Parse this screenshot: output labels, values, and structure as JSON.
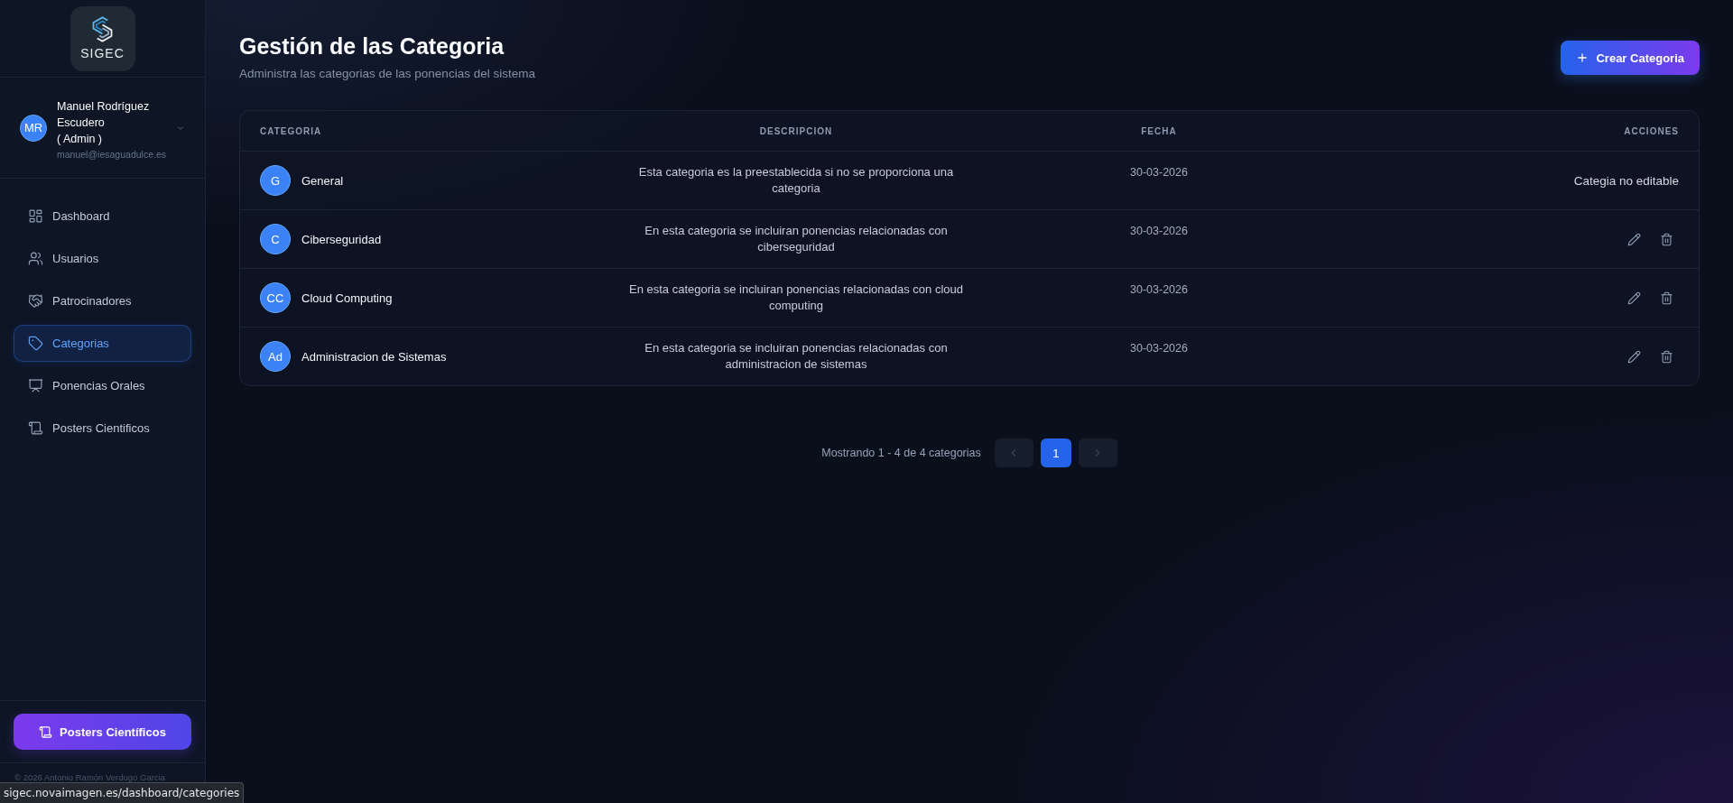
{
  "sidebar": {
    "logo": {
      "text": "SIGEC"
    },
    "user": {
      "initials": "MR",
      "name": "Manuel Rodríguez Escudero",
      "role": "( Admin )",
      "email": "manuel@iesaguadulce.es"
    },
    "nav": [
      {
        "label": "Dashboard",
        "selected": false
      },
      {
        "label": "Usuarios",
        "selected": false
      },
      {
        "label": "Patrocinadores",
        "selected": false
      },
      {
        "label": "Categorias",
        "selected": true
      },
      {
        "label": "Ponencias Orales",
        "selected": false
      },
      {
        "label": "Posters Cientificos",
        "selected": false
      }
    ],
    "bottom_button": {
      "label": "Posters Científicos"
    },
    "footer": "© 2026 Antonio Ramón Verdugo Garcia"
  },
  "header": {
    "title": "Gestión de las Categoria",
    "subtitle": "Administra las categorias de las ponencias del sistema",
    "create_button": {
      "label": "Crear Categoria"
    }
  },
  "table": {
    "columns": [
      "CATEGORIA",
      "DESCRIPCION",
      "FECHA",
      "ACCIONES"
    ],
    "rows": [
      {
        "initials": "G",
        "name": "General",
        "description": "Esta categoria es la preestablecida si no se proporciona una categoria",
        "date": "30-03-2026",
        "editable": false,
        "note": "Categia no editable"
      },
      {
        "initials": "C",
        "name": "Ciberseguridad",
        "description": "En esta categoria se incluiran ponencias relacionadas con ciberseguridad",
        "date": "30-03-2026",
        "editable": true
      },
      {
        "initials": "CC",
        "name": "Cloud Computing",
        "description": "En esta categoria se incluiran ponencias relacionadas con cloud computing",
        "date": "30-03-2026",
        "editable": true
      },
      {
        "initials": "Ad",
        "name": "Administracion de Sistemas",
        "description": "En esta categoria se incluiran ponencias relacionadas con administracion de sistemas",
        "date": "30-03-2026",
        "editable": true
      }
    ]
  },
  "pagination": {
    "summary": "Mostrando 1 - 4 de 4 categorias",
    "prev": {
      "disabled": true
    },
    "pages": [
      {
        "label": "1",
        "selected": true
      }
    ],
    "next": {
      "disabled": true
    }
  },
  "status_url": "sigec.novaimagen.es/dashboard/categories"
}
